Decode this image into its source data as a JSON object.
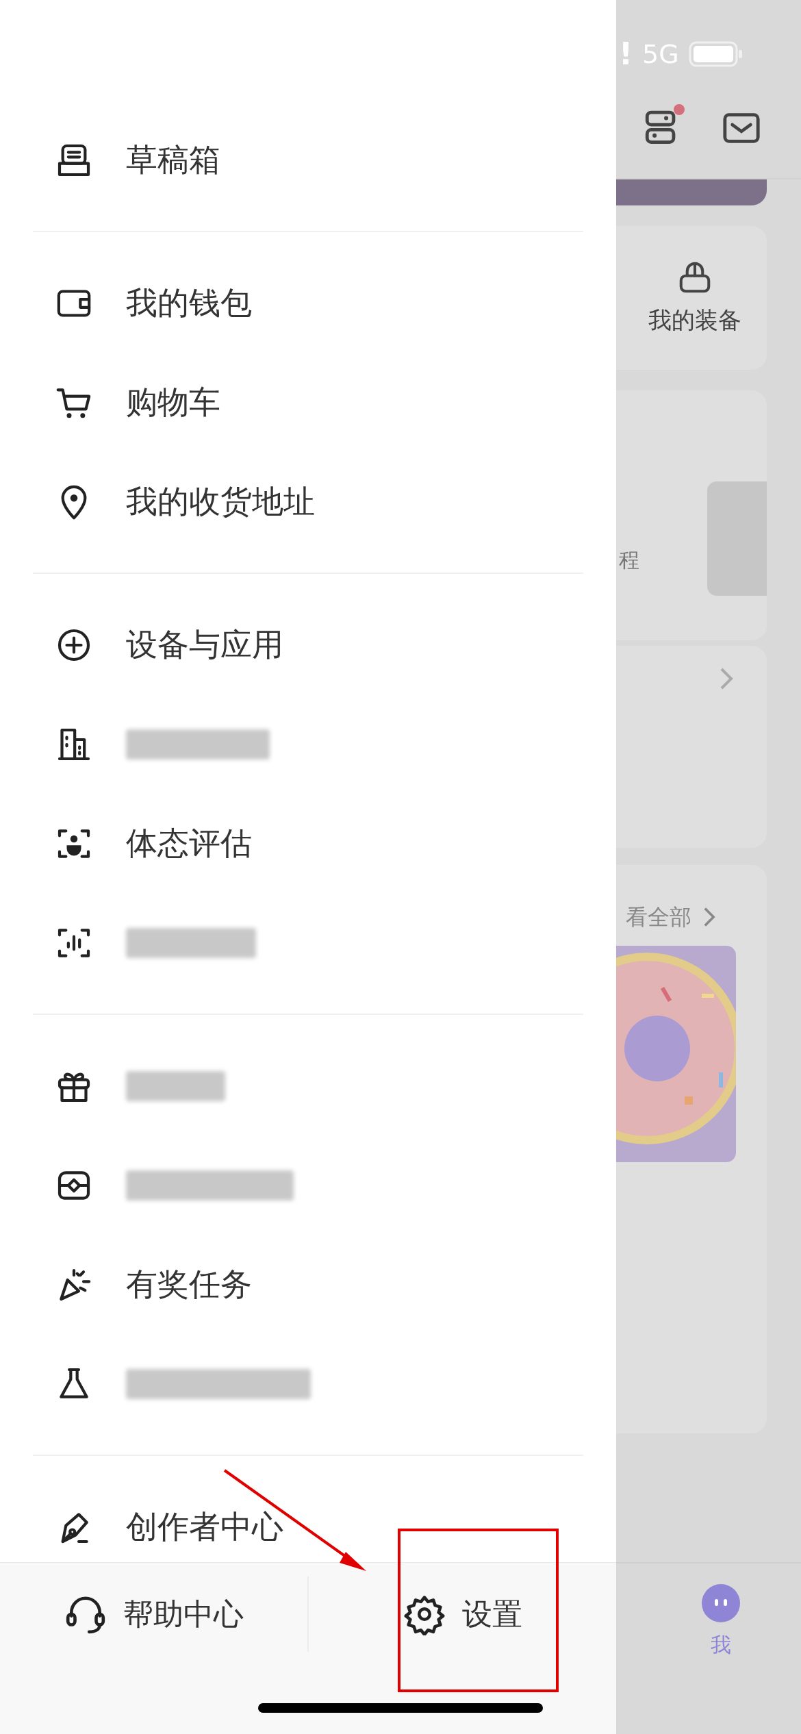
{
  "status_bar": {
    "alert": "!",
    "network": "5G"
  },
  "header_icons": [
    {
      "kind": "server",
      "badge": true
    },
    {
      "kind": "mail",
      "badge": false
    }
  ],
  "drawer_sections": [
    {
      "items": [
        {
          "kind": "text",
          "label": "草稿箱"
        }
      ]
    },
    {
      "items": [
        {
          "kind": "text",
          "label": "我的钱包"
        },
        {
          "kind": "text",
          "label": "购物车"
        },
        {
          "kind": "text",
          "label": "我的收货地址"
        }
      ]
    },
    {
      "items": [
        {
          "kind": "text",
          "label": "设备与应用"
        },
        {
          "kind": "redacted"
        },
        {
          "kind": "text",
          "label": "体态评估"
        },
        {
          "kind": "redacted"
        }
      ]
    },
    {
      "items": [
        {
          "kind": "redacted"
        },
        {
          "kind": "redacted"
        },
        {
          "kind": "text",
          "label": "有奖任务"
        },
        {
          "kind": "redacted"
        }
      ]
    },
    {
      "items": [
        {
          "kind": "text",
          "label": "创作者中心"
        }
      ]
    }
  ],
  "drawer_footer": [
    {
      "label": "帮助中心"
    },
    {
      "label": "设置"
    }
  ],
  "background_page": {
    "equipment_label": "我的装备",
    "course_text": "程",
    "gallery_link": "看全部"
  },
  "tab_bar": {
    "label": "我",
    "selected": true
  }
}
